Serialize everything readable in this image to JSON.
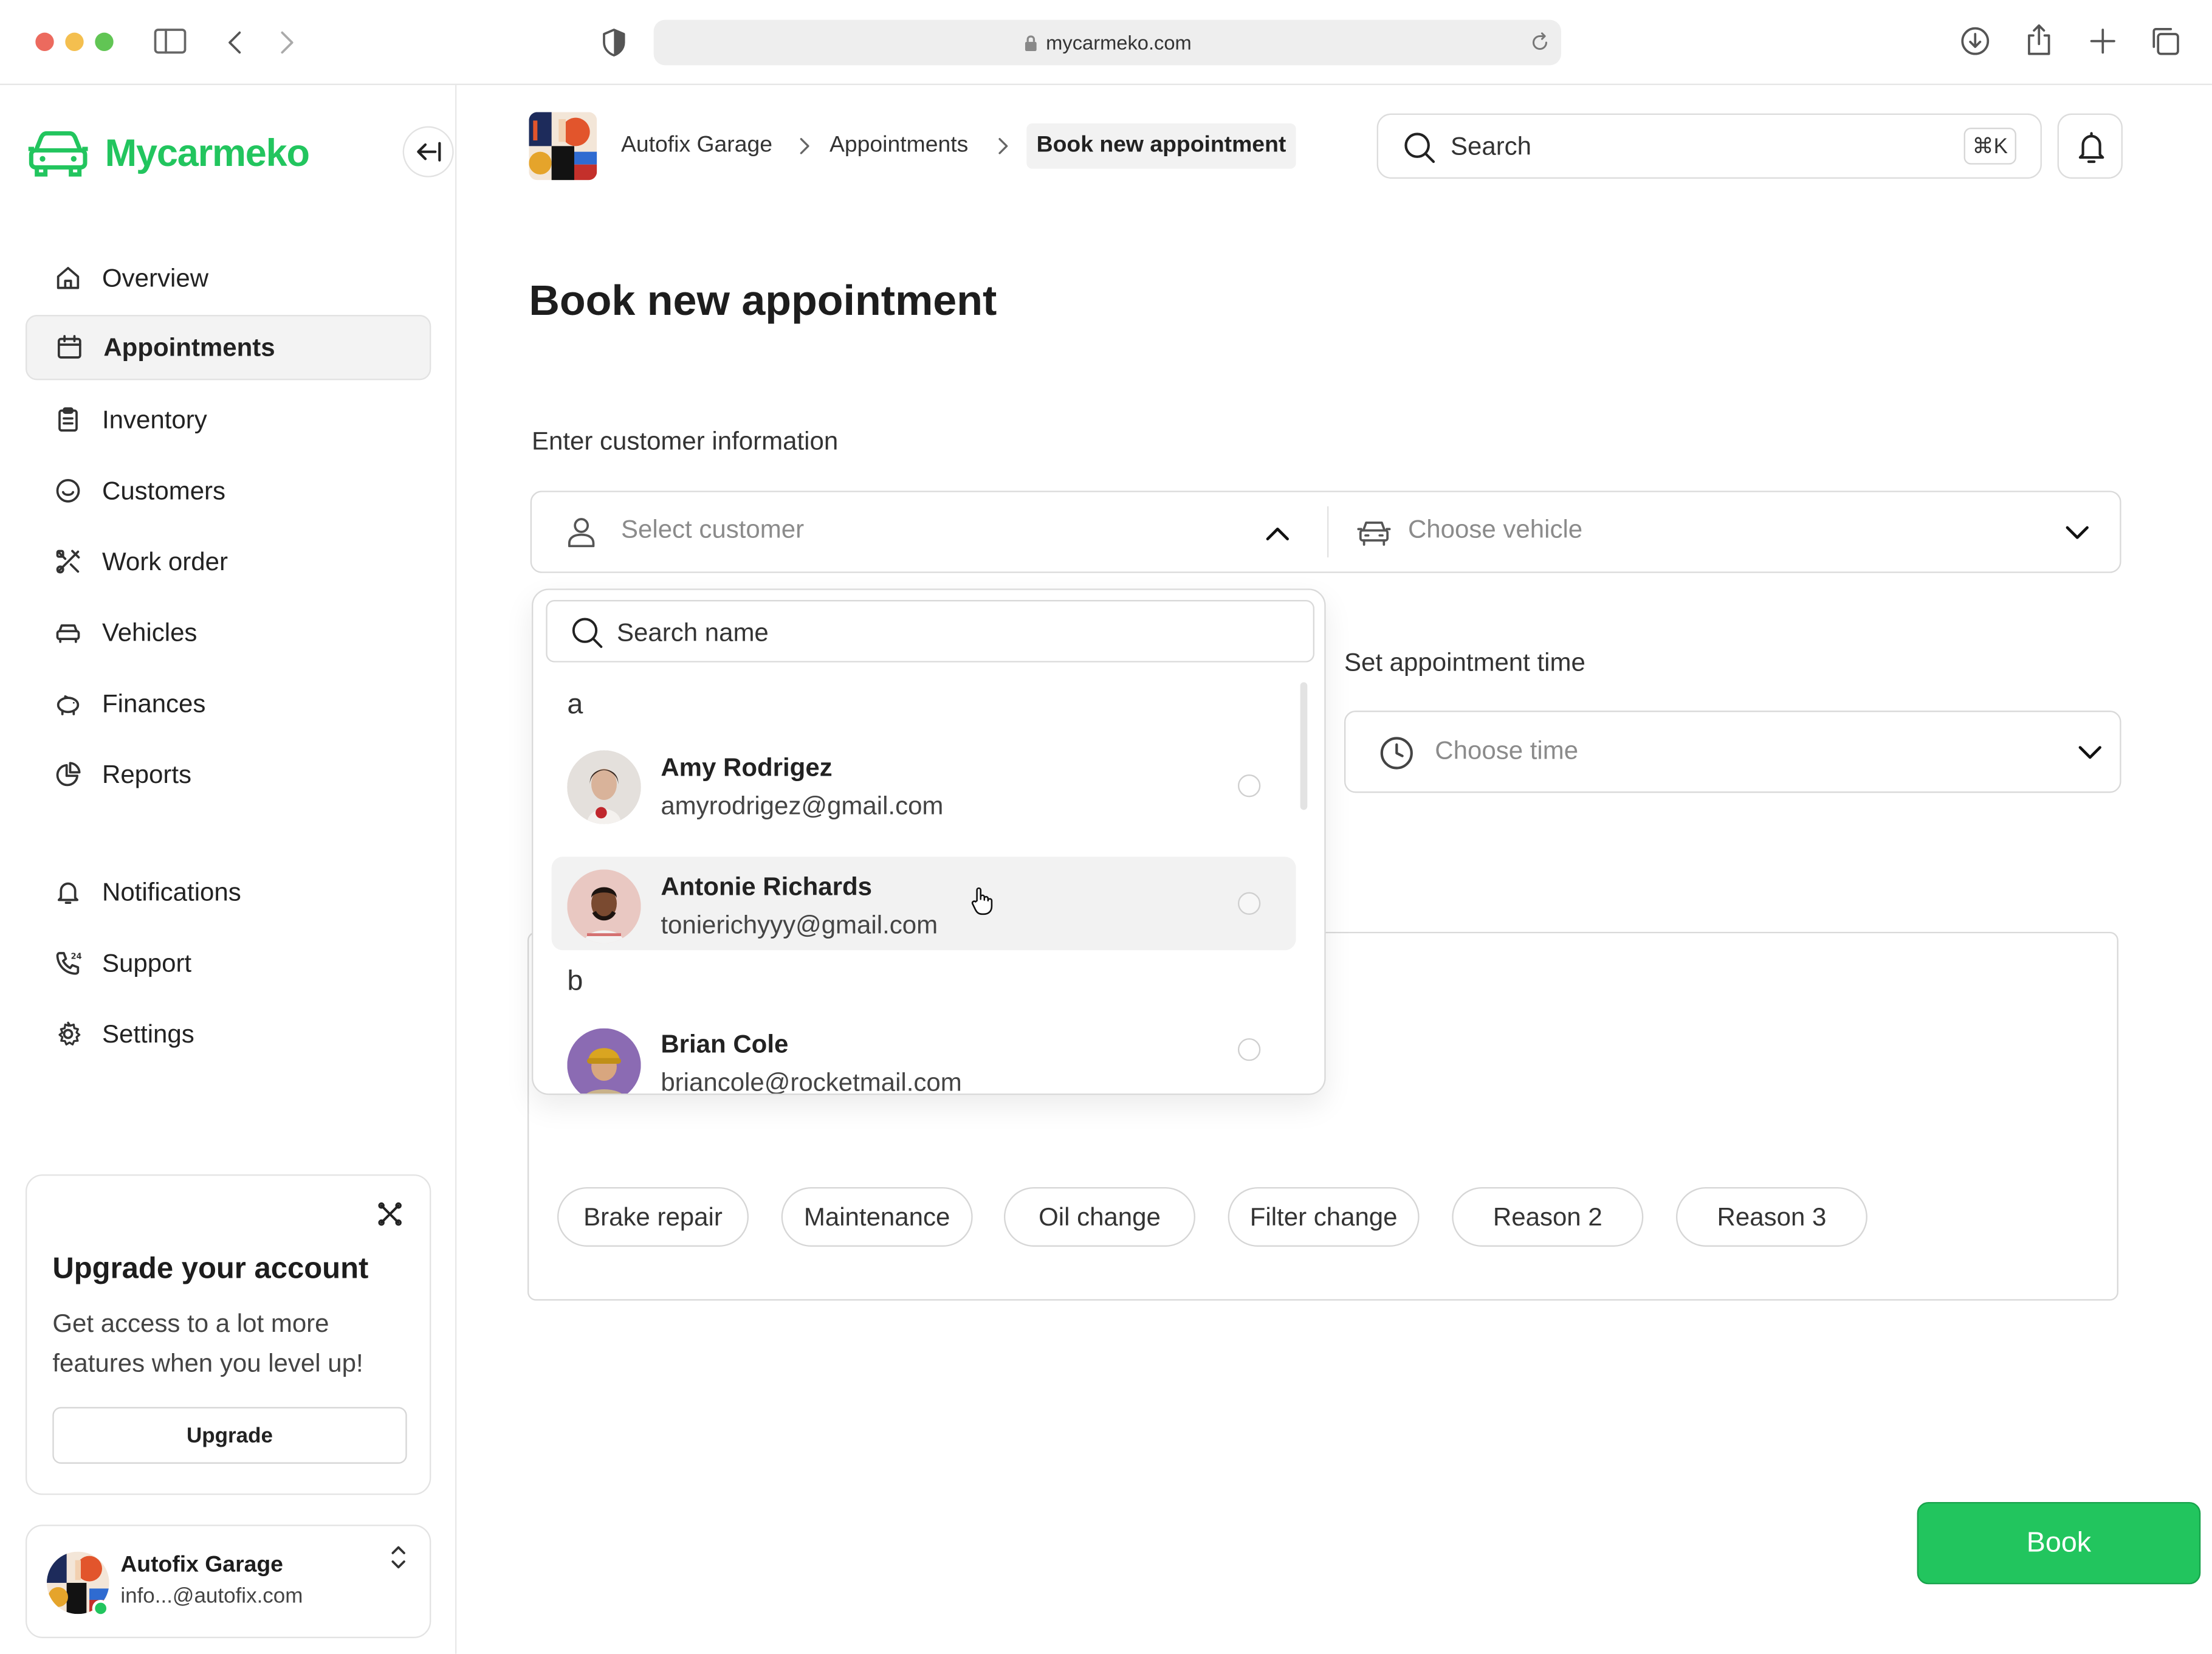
{
  "browser": {
    "url": "mycarmeko.com"
  },
  "brand": {
    "name": "Mycarmeko",
    "color": "#22c55e"
  },
  "sidebar": {
    "items": [
      {
        "label": "Overview"
      },
      {
        "label": "Appointments"
      },
      {
        "label": "Inventory"
      },
      {
        "label": "Customers"
      },
      {
        "label": "Work order"
      },
      {
        "label": "Vehicles"
      },
      {
        "label": "Finances"
      },
      {
        "label": "Reports"
      }
    ],
    "secondary": [
      {
        "label": "Notifications"
      },
      {
        "label": "Support"
      },
      {
        "label": "Settings"
      }
    ],
    "active": "Appointments"
  },
  "upgrade": {
    "title": "Upgrade your account",
    "text": "Get access to a lot more features when you level up!",
    "button": "Upgrade"
  },
  "account": {
    "name": "Autofix Garage",
    "email": "info...@autofix.com"
  },
  "breadcrumb": {
    "items": [
      "Autofix Garage",
      "Appointments",
      "Book new appointment"
    ]
  },
  "search": {
    "placeholder": "Search",
    "shortcut": "⌘K"
  },
  "page": {
    "title": "Book new appointment"
  },
  "form": {
    "customer_section_label": "Enter customer information",
    "customer_placeholder": "Select customer",
    "vehicle_placeholder": "Choose vehicle",
    "time_label": "Set appointment time",
    "time_placeholder": "Choose time",
    "reasons": [
      "Brake repair",
      "Maintenance",
      "Oil change",
      "Filter change",
      "Reason 2",
      "Reason 3"
    ],
    "book_button": "Book"
  },
  "customer_dropdown": {
    "search_placeholder": "Search name",
    "groups": [
      {
        "letter": "a",
        "customers": [
          {
            "name": "Amy Rodrigez",
            "email": "amyrodrigez@gmail.com"
          },
          {
            "name": "Antonie Richards",
            "email": "tonierichyyy@gmail.com"
          }
        ]
      },
      {
        "letter": "b",
        "customers": [
          {
            "name": "Brian Cole",
            "email": "briancole@rocketmail.com"
          }
        ]
      }
    ]
  }
}
